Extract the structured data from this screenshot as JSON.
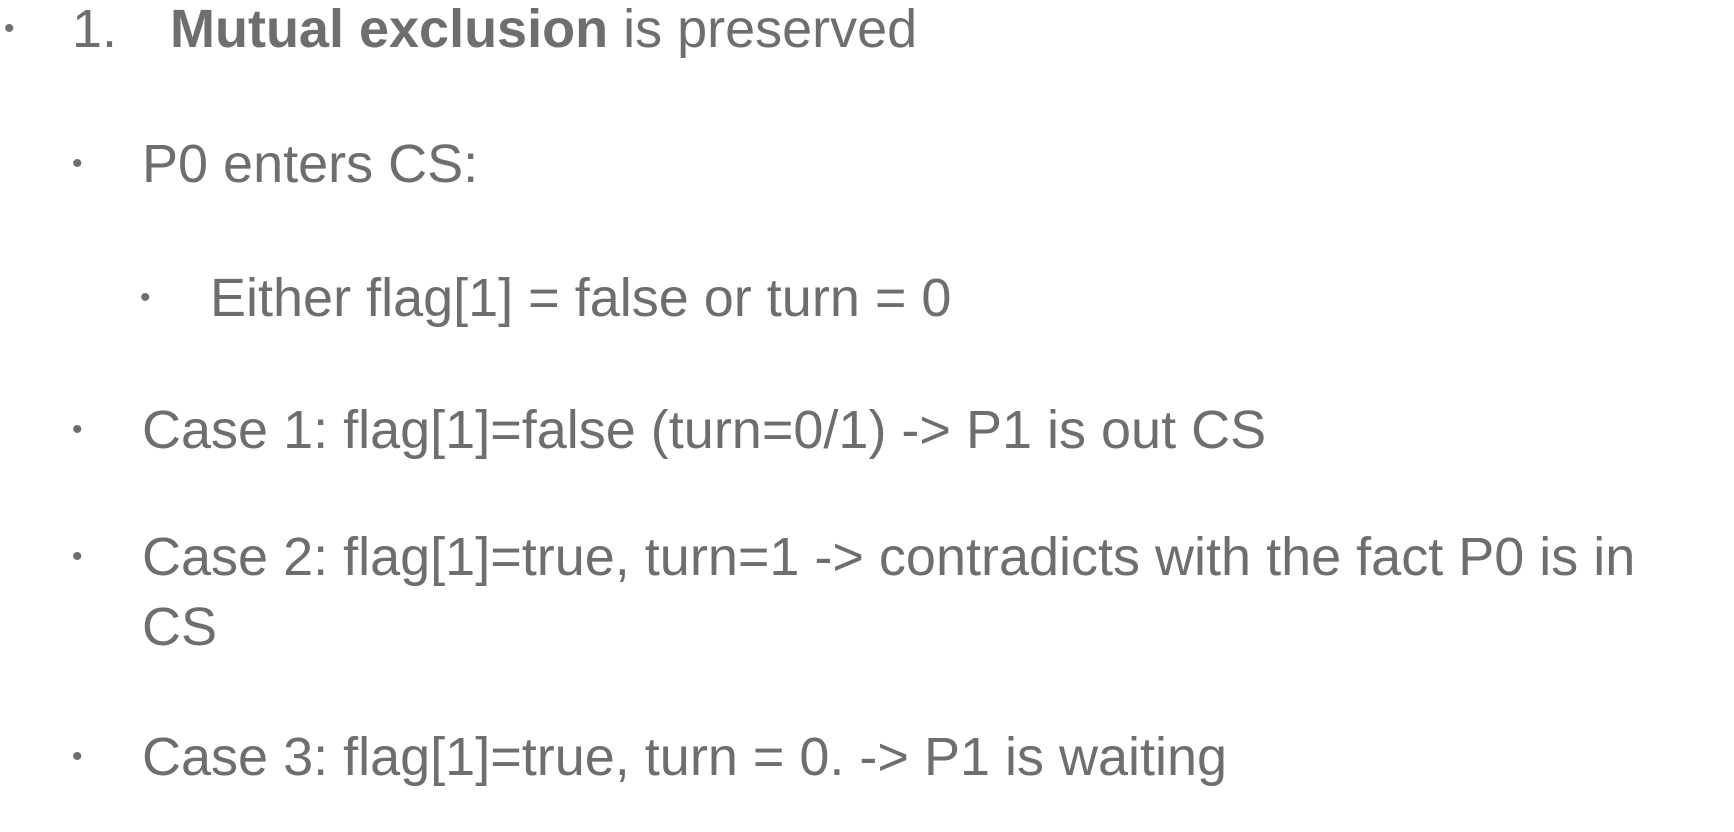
{
  "slide": {
    "item1": {
      "number": "1.",
      "bold_text": "Mutual exclusion",
      "rest_text": " is preserved"
    },
    "bullets": [
      {
        "text": "P0 enters CS:"
      },
      {
        "text": "Either flag[1] = false or turn = 0"
      },
      {
        "text": "Case 1: flag[1]=false (turn=0/1)  -> P1 is out CS"
      },
      {
        "text": "Case 2: flag[1]=true, turn=1 -> contradicts with the fact P0 is in CS"
      },
      {
        "text": "Case 3: flag[1]=true, turn = 0. -> P1 is waiting"
      }
    ]
  }
}
